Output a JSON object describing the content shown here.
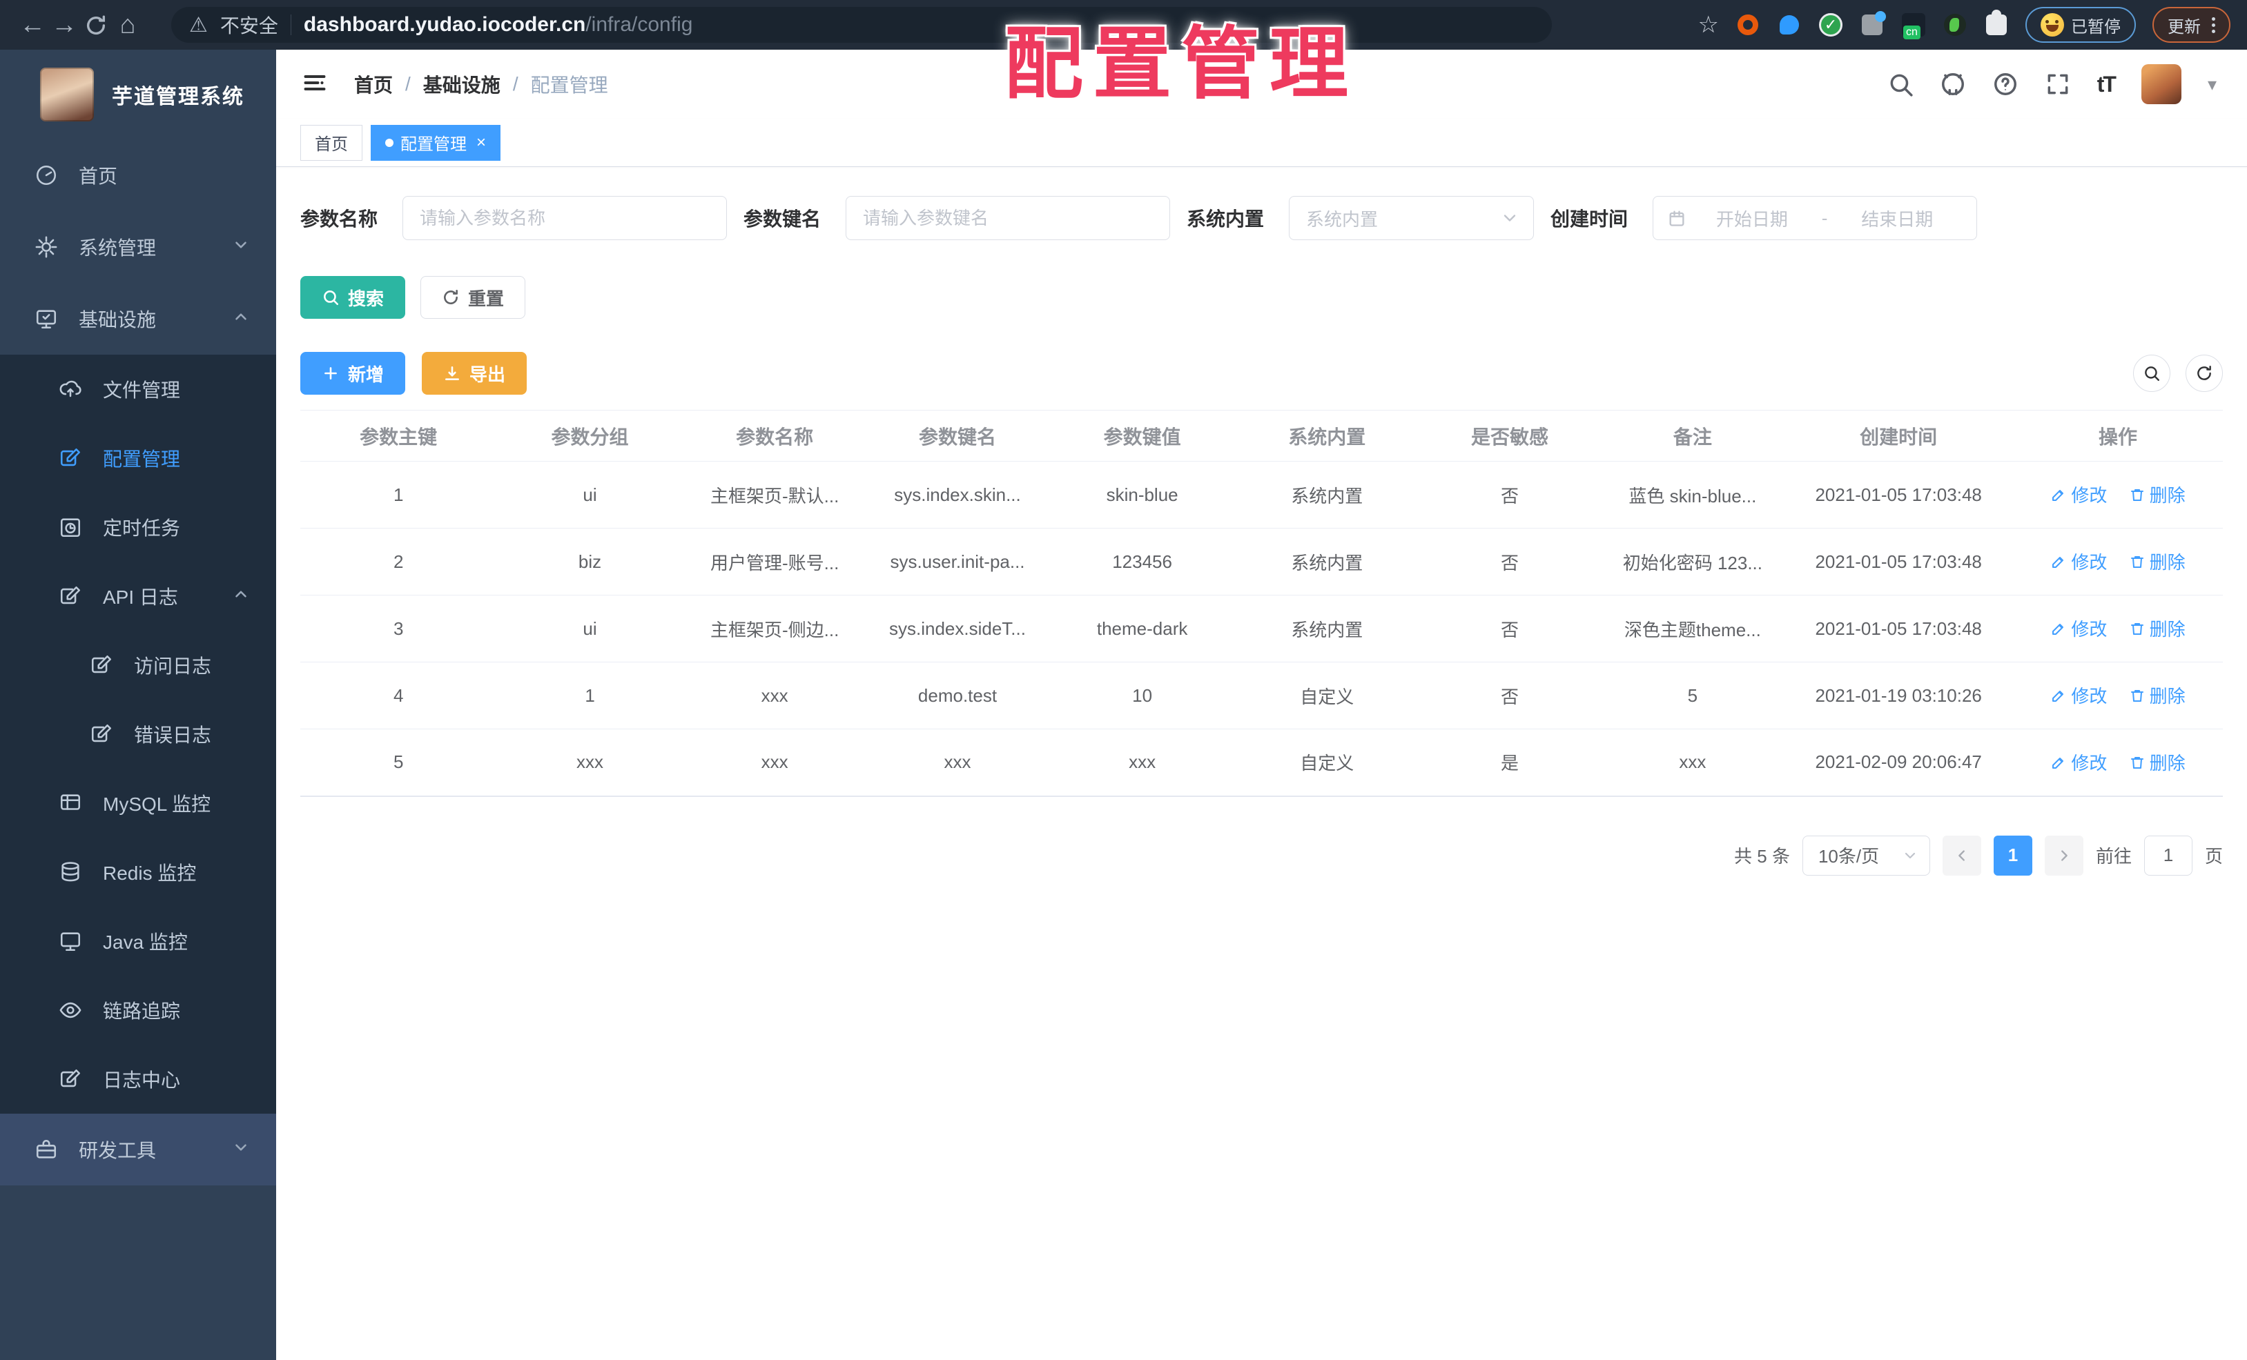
{
  "overlay_title": "配置管理",
  "browser": {
    "security_label": "不安全",
    "url_host": "dashboard.yudao.iocoder.cn",
    "url_path": "/infra/config",
    "paused_label": "已暂停",
    "update_label": "更新"
  },
  "app": {
    "title": "芋道管理系统"
  },
  "sidebar": {
    "items": [
      {
        "label": "首页"
      },
      {
        "label": "系统管理"
      },
      {
        "label": "基础设施"
      },
      {
        "label": "文件管理"
      },
      {
        "label": "配置管理"
      },
      {
        "label": "定时任务"
      },
      {
        "label": "API 日志"
      },
      {
        "label": "访问日志"
      },
      {
        "label": "错误日志"
      },
      {
        "label": "MySQL 监控"
      },
      {
        "label": "Redis 监控"
      },
      {
        "label": "Java 监控"
      },
      {
        "label": "链路追踪"
      },
      {
        "label": "日志中心"
      },
      {
        "label": "研发工具"
      }
    ]
  },
  "breadcrumb": {
    "home": "首页",
    "section": "基础设施",
    "current": "配置管理",
    "separator": "/"
  },
  "tags": {
    "home": "首页",
    "current": "配置管理",
    "close": "×"
  },
  "filters": {
    "name_label": "参数名称",
    "name_placeholder": "请输入参数名称",
    "key_label": "参数键名",
    "key_placeholder": "请输入参数键名",
    "type_label": "系统内置",
    "type_placeholder": "系统内置",
    "date_label": "创建时间",
    "date_start_placeholder": "开始日期",
    "date_separator": "-",
    "date_end_placeholder": "结束日期",
    "search_label": "搜索",
    "reset_label": "重置"
  },
  "toolbar": {
    "add_label": "新增",
    "export_label": "导出"
  },
  "table": {
    "columns": [
      "参数主键",
      "参数分组",
      "参数名称",
      "参数键名",
      "参数键值",
      "系统内置",
      "是否敏感",
      "备注",
      "创建时间",
      "操作"
    ],
    "edit_label": "修改",
    "delete_label": "删除",
    "rows": [
      {
        "cells": [
          "1",
          "ui",
          "主框架页-默认...",
          "sys.index.skin...",
          "skin-blue",
          "系统内置",
          "否",
          "蓝色 skin-blue...",
          "2021-01-05 17:03:48"
        ]
      },
      {
        "cells": [
          "2",
          "biz",
          "用户管理-账号...",
          "sys.user.init-pa...",
          "123456",
          "系统内置",
          "否",
          "初始化密码 123...",
          "2021-01-05 17:03:48"
        ]
      },
      {
        "cells": [
          "3",
          "ui",
          "主框架页-侧边...",
          "sys.index.sideT...",
          "theme-dark",
          "系统内置",
          "否",
          "深色主题theme...",
          "2021-01-05 17:03:48"
        ]
      },
      {
        "cells": [
          "4",
          "1",
          "xxx",
          "demo.test",
          "10",
          "自定义",
          "否",
          "5",
          "2021-01-19 03:10:26"
        ]
      },
      {
        "cells": [
          "5",
          "xxx",
          "xxx",
          "xxx",
          "xxx",
          "自定义",
          "是",
          "xxx",
          "2021-02-09 20:06:47"
        ]
      }
    ]
  },
  "pagination": {
    "total": "共 5 条",
    "page_size": "10条/页",
    "current_page": "1",
    "goto_label": "前往",
    "goto_value": "1",
    "page_unit": "页"
  },
  "colors": {
    "accent": "#409eff",
    "search_teal": "#2cb6a2",
    "export_orange": "#f3ab3c",
    "sidebar_bg": "#304156",
    "submenu_bg": "#1f2d3d",
    "overlay_red": "#ee3a5e"
  }
}
